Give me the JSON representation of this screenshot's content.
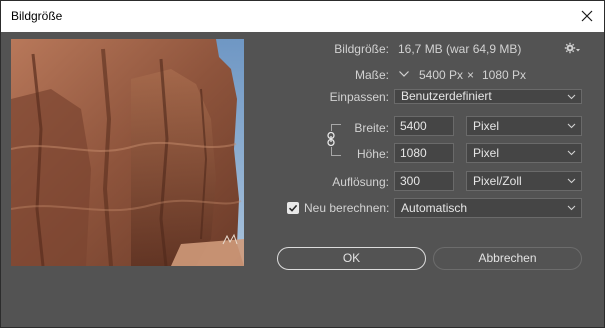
{
  "window": {
    "title": "Bildgröße"
  },
  "info": {
    "size_label": "Bildgröße:",
    "size_value": "16,7 MB (war 64,9 MB)",
    "dims_label": "Maße:",
    "dims_width": "5400 Px",
    "dims_sep": "×",
    "dims_height": "1080 Px"
  },
  "fit": {
    "label": "Einpassen:",
    "value": "Benutzerdefiniert"
  },
  "width": {
    "label": "Breite:",
    "value": "5400",
    "unit": "Pixel"
  },
  "height": {
    "label": "Höhe:",
    "value": "1080",
    "unit": "Pixel"
  },
  "resolution": {
    "label": "Auflösung:",
    "value": "300",
    "unit": "Pixel/Zoll"
  },
  "resample": {
    "label": "Neu berechnen:",
    "checked": true,
    "value": "Automatisch"
  },
  "buttons": {
    "ok": "OK",
    "cancel": "Abbrechen"
  },
  "icons": {
    "close": "close-icon",
    "gear": "gear-icon",
    "dims_toggle": "chevron-down-icon",
    "link": "chain-link-icon",
    "checkbox": "checkmark-icon"
  },
  "colors": {
    "panel": "#535353",
    "titlebar": "#ffffff",
    "field_bg": "#454545"
  }
}
